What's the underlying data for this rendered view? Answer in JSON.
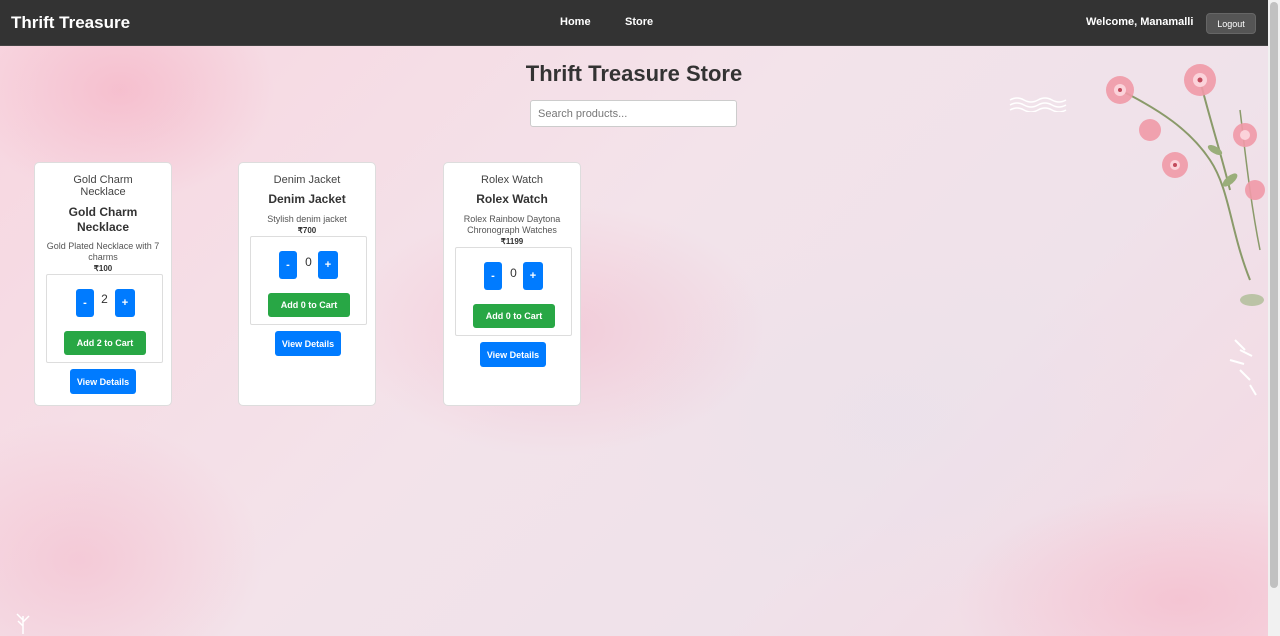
{
  "navbar": {
    "brand": "Thrift Treasure",
    "links": [
      "Home",
      "Store"
    ],
    "welcome": "Welcome, Manamalli",
    "logout_label": "Logout"
  },
  "page": {
    "title": "Thrift Treasure Store",
    "search_placeholder": "Search products..."
  },
  "products": [
    {
      "image_alt": "Gold Charm Necklace",
      "name": "Gold Charm Necklace",
      "description": "Gold Plated Necklace with 7 charms",
      "price": "₹100",
      "quantity": "2",
      "minus": "-",
      "plus": "+",
      "add_label": "Add 2 to Cart",
      "details_label": "View Details"
    },
    {
      "image_alt": "Denim Jacket",
      "name": "Denim Jacket",
      "description": "Stylish denim jacket",
      "price": "₹700",
      "quantity": "0",
      "minus": "-",
      "plus": "+",
      "add_label": "Add 0 to Cart",
      "details_label": "View Details"
    },
    {
      "image_alt": "Rolex Watch",
      "name": "Rolex Watch",
      "description": "Rolex Rainbow Daytona Chronograph Watches",
      "price": "₹1199",
      "quantity": "0",
      "minus": "-",
      "plus": "+",
      "add_label": "Add 0 to Cart",
      "details_label": "View Details"
    }
  ],
  "colors": {
    "navbar": "#333333",
    "primary": "#007bff",
    "success": "#28a745",
    "background": "#f7e3ea"
  }
}
